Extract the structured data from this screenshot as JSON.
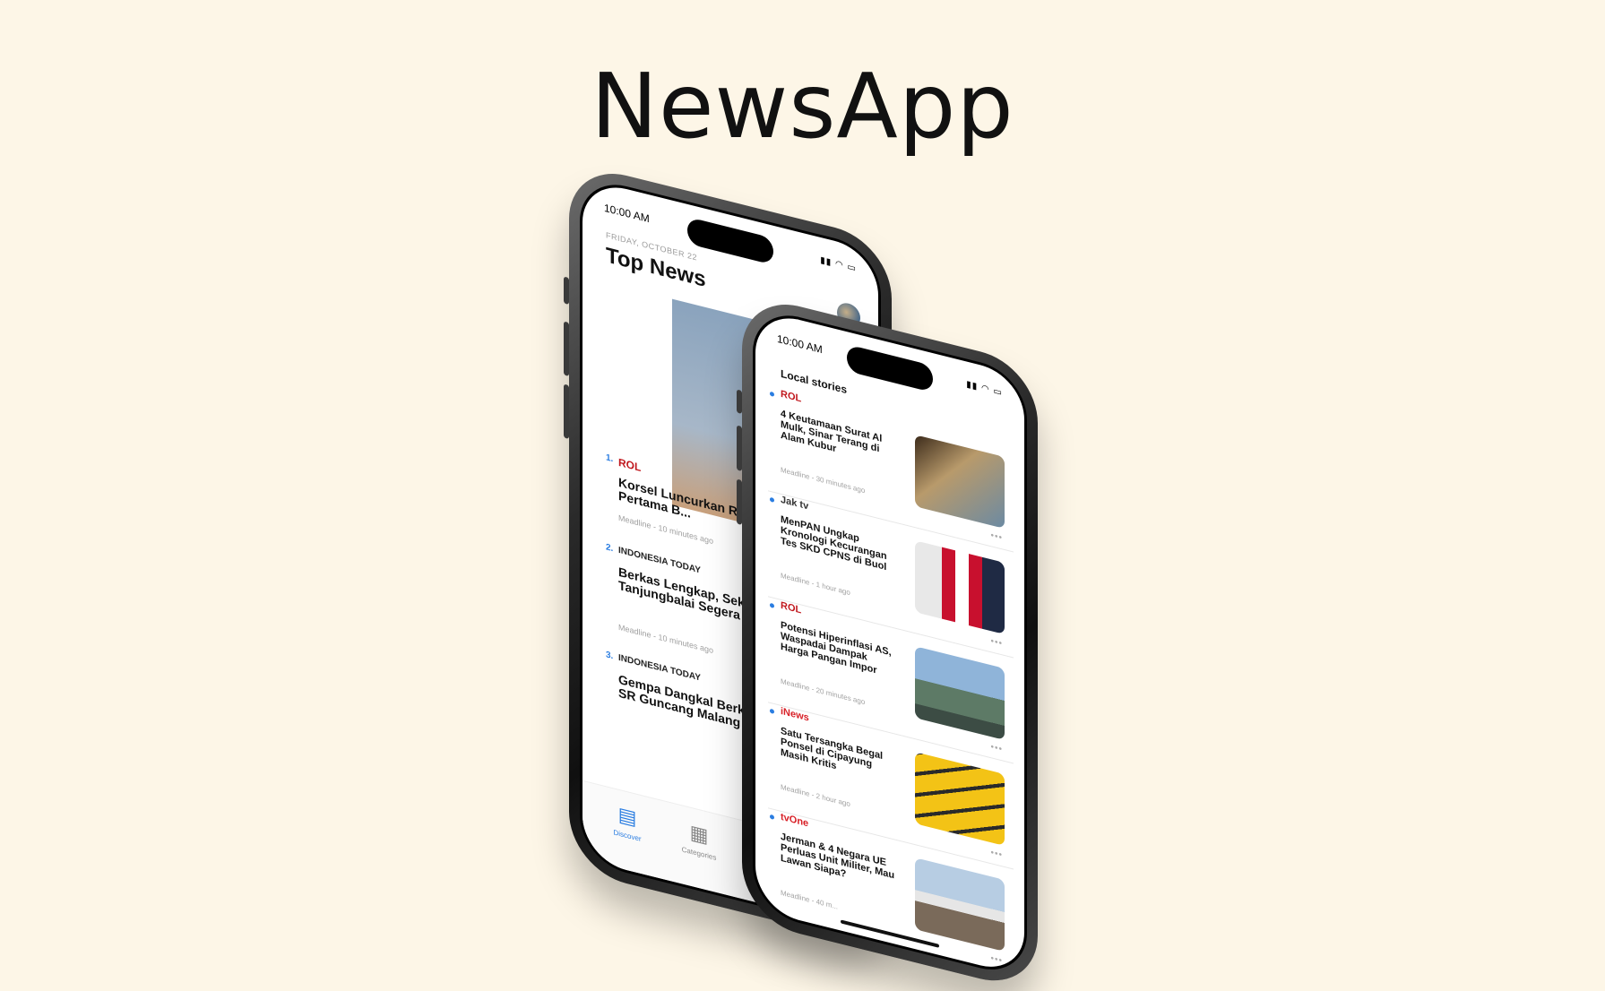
{
  "app_title": "NewsApp",
  "back_phone": {
    "status_time": "10:00 AM",
    "date": "FRIDAY, OCTOBER 22",
    "title": "Top News",
    "items": [
      {
        "num": "1.",
        "source": "ROL",
        "headline": "Korsel Luncurkan R... Angkasa Pertama B...",
        "meta": "Meadline - 10 minutes ago"
      },
      {
        "num": "2.",
        "source": "INDONESIA TODAY",
        "headline": "Berkas Lengkap, Sekda Tanjungbalai Segera Disidang",
        "meta": "Meadline - 10 minutes ago"
      },
      {
        "num": "3.",
        "source": "INDONESIA TODAY",
        "headline": "Gempa Dangkal Berkekuatan 5,3 SR Guncang Malang",
        "meta": ""
      }
    ],
    "tabs": [
      {
        "label": "Discover",
        "icon": "document-icon"
      },
      {
        "label": "Categories",
        "icon": "grid-icon"
      }
    ]
  },
  "front_phone": {
    "status_time": "10:00 AM",
    "section": "Local stories",
    "stories": [
      {
        "source": "ROL",
        "source_color": "#c0161c",
        "headline": "4 Keutamaan Surat Al Mulk, Sinar Terang di Alam Kubur",
        "meta": "Meadline - 30 minutes ago",
        "thumb": "book"
      },
      {
        "source": "Jak tv",
        "source_color": "#333333",
        "headline": "MenPAN Ungkap Kronologi Kecurangan Tes SKD CPNS di Buol",
        "meta": "Meadline - 1 hour ago",
        "thumb": "flag"
      },
      {
        "source": "ROL",
        "source_color": "#c0161c",
        "headline": "Potensi Hiperinflasi AS, Waspadai Dampak Harga Pangan Impor",
        "meta": "Meadline - 20 minutes ago",
        "thumb": "port"
      },
      {
        "source": "iNews",
        "source_color": "#d81f26",
        "headline": "Satu Tersangka Begal Ponsel di Cipayung Masih Kritis",
        "meta": "Meadline - 2 hour ago",
        "thumb": "police"
      },
      {
        "source": "tvOne",
        "source_color": "#d81f26",
        "headline": "Jerman & 4 Negara UE Perluas Unit Militer, Mau Lawan Siapa?",
        "meta": "Meadline - 40 m...",
        "thumb": "plane"
      }
    ]
  }
}
